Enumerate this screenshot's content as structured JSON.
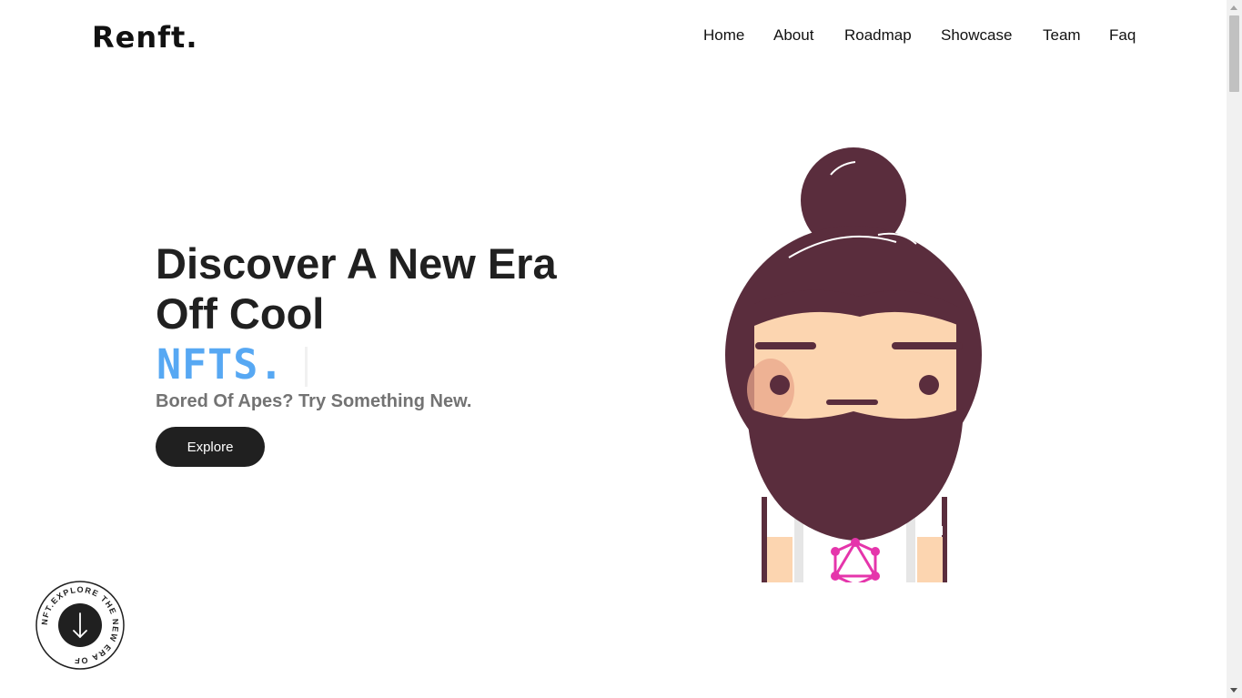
{
  "brand": {
    "logo": "Renft."
  },
  "nav": {
    "items": [
      {
        "label": "Home"
      },
      {
        "label": "About"
      },
      {
        "label": "Roadmap"
      },
      {
        "label": "Showcase"
      },
      {
        "label": "Team"
      },
      {
        "label": "Faq"
      }
    ]
  },
  "hero": {
    "title_line1": "Discover A New Era",
    "title_line2": "Off Cool",
    "typed_text": "NFTS.",
    "subtitle": "Bored Of Apes? Try Something New.",
    "cta_label": "Explore"
  },
  "badge": {
    "ring_text": "NFT.EXPLORE THE NEW ERA OF ",
    "icon": "arrow-down-icon"
  },
  "colors": {
    "accent_blue": "#57a8f3",
    "dark": "#202020",
    "avatar_hair": "#5a2d3d",
    "avatar_skin": "#fcd5b0",
    "avatar_symbol": "#e535ab"
  }
}
